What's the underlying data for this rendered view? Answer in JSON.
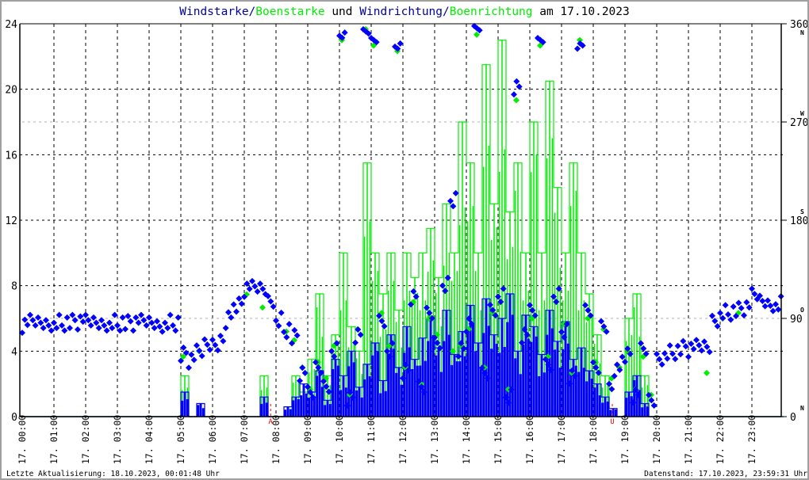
{
  "title": {
    "part1": "Windstarke/",
    "part2": "Boenstarke",
    "part3": " und ",
    "part4": "Windrichtung/",
    "part5": "Boenrichtung",
    "part6": " am 17.10.2023"
  },
  "footer": {
    "last_update": "Letzte Aktualisierung: 18.10.2023, 00:01:48 Uhr",
    "data_status": "Datenstand: 17.10.2023, 23:59:31 Uhr"
  },
  "colors": {
    "wind": "#0000ff",
    "gust": "#00ee00",
    "title_blue": "#0000a0",
    "sun": "#ff0000",
    "grid": "#000000",
    "grid_light": "#b0b0b0"
  },
  "chart_data": {
    "type": "line",
    "title": "Windstarke/Boenstarke und Windrichtung/Boenrichtung am 17.10.2023",
    "x_unit": "hour of day",
    "xlim": [
      0,
      24
    ],
    "x_tick_labels": [
      "17. 00:00",
      "17. 01:00",
      "17. 02:00",
      "17. 03:00",
      "17. 04:00",
      "17. 05:00",
      "17. 06:00",
      "17. 07:00",
      "17. 08:00",
      "17. 09:00",
      "17. 10:00",
      "17. 11:00",
      "17. 12:00",
      "17. 13:00",
      "17. 14:00",
      "17. 15:00",
      "17. 16:00",
      "17. 17:00",
      "17. 18:00",
      "17. 19:00",
      "17. 20:00",
      "17. 21:00",
      "17. 22:00",
      "17. 23:00"
    ],
    "y_left": {
      "ylim": [
        0,
        24
      ],
      "ticks": [
        "0",
        "4",
        "8",
        "12",
        "16",
        "20",
        "24"
      ]
    },
    "y_right": {
      "ylim": [
        0,
        360
      ],
      "ticks": [
        "0",
        "90",
        "180",
        "270",
        "360"
      ],
      "compass": [
        {
          "deg": 360,
          "label": "N"
        },
        {
          "deg": 270,
          "label": "W"
        },
        {
          "deg": 180,
          "label": "S"
        },
        {
          "deg": 90,
          "label": "O"
        },
        {
          "deg": 0,
          "label": "N"
        }
      ]
    },
    "grid": true,
    "sample_interval_minutes": 15,
    "annotations": [
      {
        "label": "A",
        "hour": 7.83
      },
      {
        "label": "U",
        "hour": 18.6
      }
    ],
    "series": [
      {
        "name": "Windstarke",
        "axis": "left",
        "style": "line",
        "values": [
          0,
          0,
          0,
          0,
          0,
          0,
          0,
          0,
          0,
          0,
          0,
          0,
          0,
          0,
          0,
          0,
          0,
          0,
          0,
          0,
          1.5,
          0,
          0.8,
          0,
          0,
          0,
          0,
          0,
          0,
          0,
          1.2,
          0,
          0,
          0.6,
          1.2,
          2.0,
          1.5,
          2.8,
          1.0,
          3.5,
          2.5,
          4.0,
          1.8,
          3.2,
          4.5,
          2.2,
          5.0,
          3.0,
          5.5,
          3.5,
          4.8,
          6.0,
          4.2,
          6.5,
          3.8,
          5.2,
          6.8,
          4.5,
          7.2,
          5.0,
          6.0,
          7.5,
          4.0,
          6.2,
          5.5,
          3.8,
          6.5,
          4.6,
          5.8,
          3.5,
          4.2,
          2.8,
          2.0,
          1.2,
          0.5,
          0,
          1.5,
          2.5,
          0.8,
          0,
          0,
          0,
          0,
          0,
          0,
          0,
          0,
          0,
          0,
          0,
          0,
          0,
          0,
          0,
          0,
          0
        ]
      },
      {
        "name": "Boenstarke",
        "axis": "left",
        "style": "line",
        "values": [
          0,
          0,
          0,
          0,
          0,
          0,
          0,
          0,
          0,
          0,
          0,
          0,
          0,
          0,
          0,
          0,
          0,
          0,
          0,
          0,
          2.5,
          0,
          0,
          0,
          0,
          0,
          0,
          0,
          0,
          0,
          2.5,
          0,
          0,
          0,
          2.5,
          1.5,
          3.5,
          7.5,
          2.5,
          5.0,
          10.0,
          5.5,
          4.0,
          15.5,
          10.0,
          7.5,
          10.0,
          6.5,
          10.0,
          8.5,
          10.0,
          11.5,
          8.5,
          13.0,
          10.0,
          18.0,
          15.5,
          10.0,
          21.5,
          13.0,
          23.0,
          12.5,
          15.5,
          10.0,
          18.0,
          10.0,
          20.5,
          14.0,
          10.0,
          15.5,
          10.0,
          7.5,
          5.0,
          2.5,
          0,
          0,
          6.0,
          7.5,
          2.5,
          0,
          0,
          0,
          0,
          0,
          0,
          0,
          0,
          0,
          0,
          0,
          0,
          0,
          0,
          0,
          0,
          0
        ]
      },
      {
        "name": "Windrichtung",
        "axis": "right",
        "style": "points",
        "values": [
          84,
          86,
          86,
          86,
          86,
          86,
          86,
          87,
          86,
          86,
          86,
          86,
          86,
          85,
          86,
          86,
          86,
          85,
          86,
          86,
          56,
          52,
          58,
          66,
          68,
          74,
          98,
          101,
          117,
          117,
          117,
          108,
          88,
          80,
          72,
          40,
          20,
          45,
          30,
          60,
          350,
          15,
          75,
          352,
          345,
          90,
          60,
          340,
          40,
          110,
          25,
          95,
          70,
          120,
          200,
          60,
          85,
          355,
          40,
          100,
          110,
          20,
          300,
          75,
          95,
          345,
          50,
          110,
          80,
          35,
          340,
          95,
          45,
          85,
          30,
          50,
          55,
          20,
          60,
          15,
          55,
          58,
          60,
          62,
          62,
          63,
          64,
          90,
          95,
          96,
          97,
          100,
          110,
          106,
          104,
          103
        ]
      },
      {
        "name": "Boenrichtung",
        "axis": "right",
        "style": "points",
        "values": [
          null,
          null,
          null,
          null,
          null,
          null,
          null,
          null,
          null,
          null,
          null,
          null,
          null,
          null,
          null,
          null,
          null,
          null,
          null,
          null,
          55,
          null,
          60,
          null,
          null,
          null,
          null,
          null,
          112,
          null,
          100,
          null,
          null,
          78,
          70,
          45,
          25,
          50,
          35,
          65,
          345,
          20,
          80,
          355,
          340,
          95,
          65,
          335,
          45,
          105,
          30,
          90,
          75,
          115,
          60,
          65,
          80,
          350,
          45,
          95,
          105,
          25,
          290,
          80,
          90,
          340,
          55,
          105,
          85,
          40,
          345,
          90,
          50,
          80,
          35,
          45,
          60,
          25,
          55,
          20,
          null,
          null,
          null,
          null,
          null,
          null,
          40,
          null,
          90,
          null,
          95,
          null,
          null,
          null,
          null,
          null
        ]
      }
    ]
  }
}
